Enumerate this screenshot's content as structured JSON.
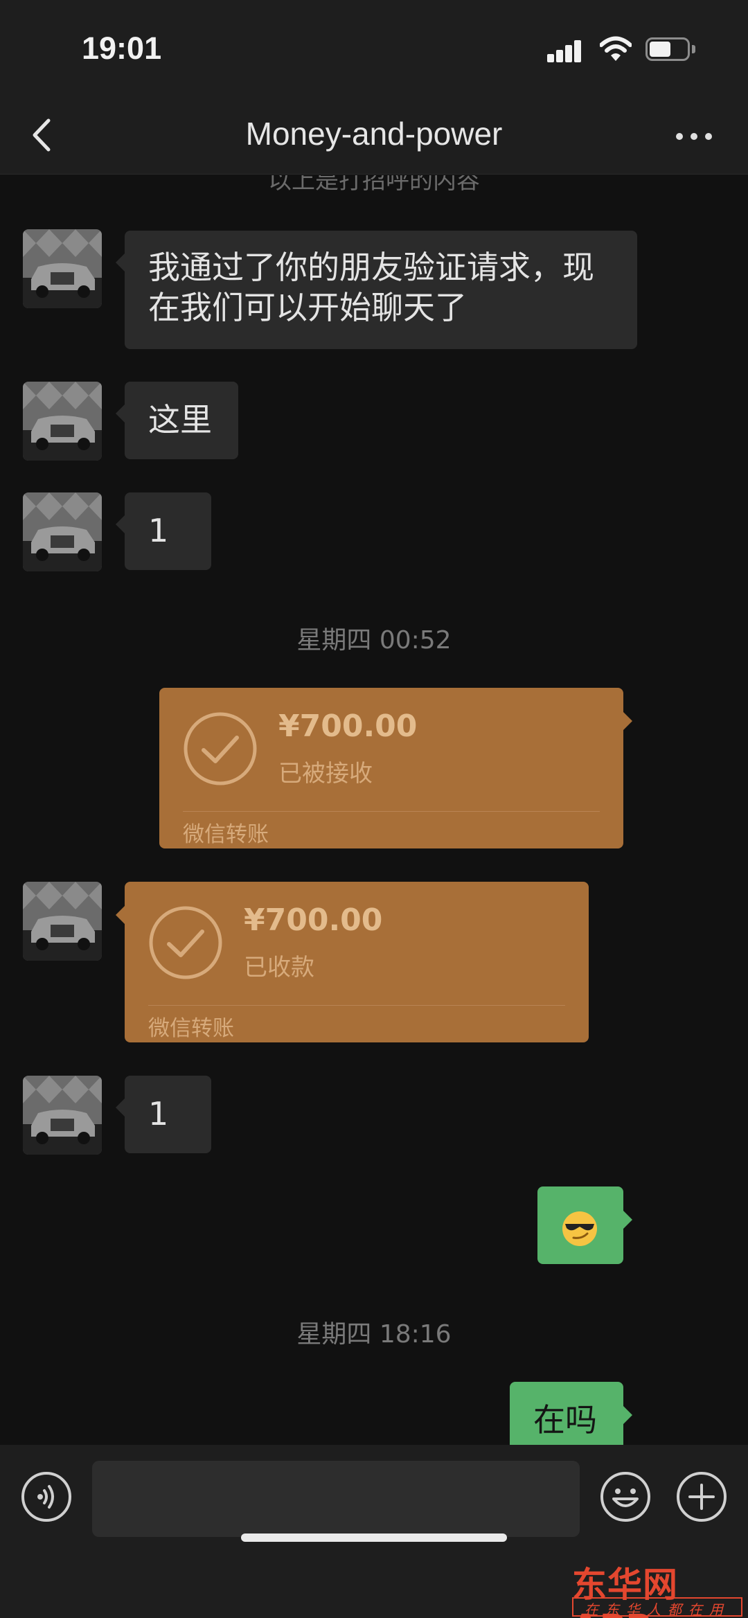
{
  "status_bar": {
    "time": "19:01"
  },
  "nav": {
    "title": "Money-and-power"
  },
  "chat": {
    "cutoff_text": "以上是打招呼的内容",
    "messages": [
      {
        "text": "我通过了你的朋友验证请求，现在我们可以开始聊天了"
      },
      {
        "text": "这里"
      },
      {
        "text": "1"
      },
      {
        "text": "1"
      }
    ],
    "msg0_line1": "我通过了你的朋友验证请求，现",
    "msg0_line2": "在我们可以开始聊天了",
    "timestamp1": "星期四 00:52",
    "transfer_sent": {
      "amount": "¥700.00",
      "status": "已被接收",
      "label": "微信转账"
    },
    "transfer_received": {
      "amount": "¥700.00",
      "status": "已收款",
      "label": "微信转账"
    },
    "emoji_message": "smirking-face-with-sunglasses",
    "timestamp2": "星期四 18:16",
    "last_sent": "在吗"
  },
  "input_bar": {
    "placeholder": ""
  },
  "watermark": {
    "brand": "东华网APP",
    "slogan": "在东华人都在用"
  },
  "colors": {
    "background": "#111111",
    "bar": "#1e1e1e",
    "bubble_incoming": "#2b2b2b",
    "bubble_outgoing": "#56b36a",
    "transfer_card": "#a86f38",
    "watermark": "#e4472f"
  }
}
